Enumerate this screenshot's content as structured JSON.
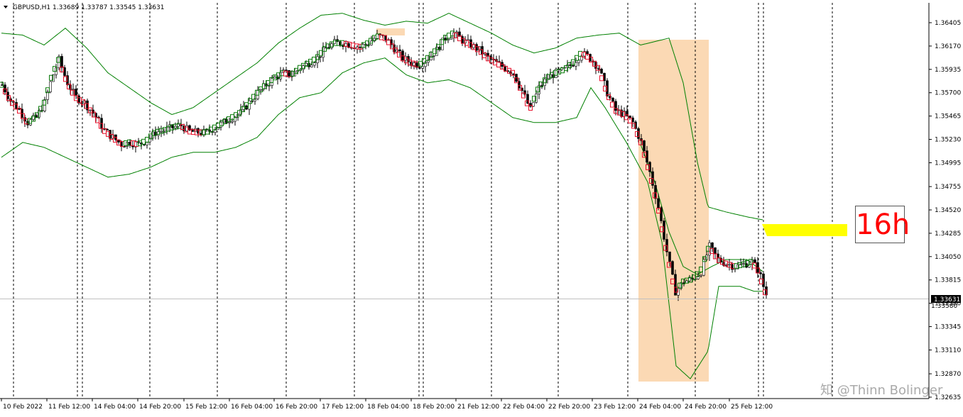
{
  "header": {
    "symbol": "GBPUSD,H1",
    "ohlc": "1.33689 1.33787 1.33545 1.33631",
    "dropdown_icon": "triangle-down-icon"
  },
  "price_label": "1.33631",
  "price_label_behind": "1.33580",
  "annotation": {
    "text": "16h",
    "text_color": "#ff0000",
    "yellow_band_color": "#ffff00"
  },
  "watermark": "@Thinn Bolinger",
  "watermark_icon": "zhihu-icon",
  "colors": {
    "candle": "#000000",
    "band_line": "#008000",
    "bear_box": "#e8102a",
    "bull_box": "#0a7a0a",
    "highlight": "#fbd9b4",
    "grid_sep": "#000000"
  },
  "chart_data": {
    "type": "candlestick",
    "title": "GBPUSD,H1",
    "y_ticks": [
      "1.36405",
      "1.36170",
      "1.35935",
      "1.35700",
      "1.35465",
      "1.35230",
      "1.34995",
      "1.34755",
      "1.34520",
      "1.34285",
      "1.34050",
      "1.33815",
      "1.33580",
      "1.33345",
      "1.33110",
      "1.32870",
      "1.32635"
    ],
    "ylim": [
      1.32635,
      1.366
    ],
    "x_ticks": [
      "10 Feb 2022",
      "11 Feb 12:00",
      "14 Feb 04:00",
      "14 Feb 20:00",
      "15 Feb 12:00",
      "16 Feb 04:00",
      "16 Feb 20:00",
      "17 Feb 12:00",
      "18 Feb 04:00",
      "18 Feb 20:00",
      "21 Feb 12:00",
      "22 Feb 04:00",
      "22 Feb 20:00",
      "23 Feb 12:00",
      "24 Feb 04:00",
      "24 Feb 20:00",
      "25 Feb 12:00"
    ],
    "price_path": [
      [
        0,
        1.3578
      ],
      [
        12,
        1.3562
      ],
      [
        24,
        1.3553
      ],
      [
        36,
        1.354
      ],
      [
        48,
        1.3545
      ],
      [
        60,
        1.356
      ],
      [
        70,
        1.3585
      ],
      [
        80,
        1.3603
      ],
      [
        92,
        1.358
      ],
      [
        104,
        1.3565
      ],
      [
        116,
        1.356
      ],
      [
        130,
        1.3548
      ],
      [
        144,
        1.3532
      ],
      [
        156,
        1.3525
      ],
      [
        168,
        1.3518
      ],
      [
        180,
        1.352
      ],
      [
        192,
        1.3518
      ],
      [
        204,
        1.3522
      ],
      [
        216,
        1.353
      ],
      [
        228,
        1.3532
      ],
      [
        240,
        1.3535
      ],
      [
        252,
        1.3537
      ],
      [
        264,
        1.3531
      ],
      [
        276,
        1.353
      ],
      [
        288,
        1.353
      ],
      [
        300,
        1.3535
      ],
      [
        312,
        1.354
      ],
      [
        324,
        1.3545
      ],
      [
        336,
        1.355
      ],
      [
        348,
        1.356
      ],
      [
        360,
        1.357
      ],
      [
        372,
        1.3578
      ],
      [
        384,
        1.3585
      ],
      [
        396,
        1.359
      ],
      [
        408,
        1.3588
      ],
      [
        420,
        1.3595
      ],
      [
        432,
        1.36
      ],
      [
        444,
        1.3605
      ],
      [
        456,
        1.3615
      ],
      [
        468,
        1.362
      ],
      [
        480,
        1.362
      ],
      [
        492,
        1.3618
      ],
      [
        504,
        1.3616
      ],
      [
        516,
        1.362
      ],
      [
        528,
        1.3627
      ],
      [
        540,
        1.3625
      ],
      [
        552,
        1.3615
      ],
      [
        564,
        1.3605
      ],
      [
        576,
        1.36
      ],
      [
        588,
        1.3598
      ],
      [
        600,
        1.3605
      ],
      [
        612,
        1.3613
      ],
      [
        624,
        1.3625
      ],
      [
        636,
        1.363
      ],
      [
        648,
        1.3623
      ],
      [
        660,
        1.3618
      ],
      [
        672,
        1.3613
      ],
      [
        684,
        1.3605
      ],
      [
        696,
        1.36
      ],
      [
        708,
        1.3595
      ],
      [
        720,
        1.359
      ],
      [
        732,
        1.3572
      ],
      [
        744,
        1.3553
      ],
      [
        756,
        1.3575
      ],
      [
        768,
        1.3585
      ],
      [
        780,
        1.359
      ],
      [
        792,
        1.3593
      ],
      [
        804,
        1.36
      ],
      [
        816,
        1.361
      ],
      [
        828,
        1.3605
      ],
      [
        840,
        1.3595
      ],
      [
        852,
        1.357
      ],
      [
        864,
        1.3552
      ],
      [
        876,
        1.3548
      ],
      [
        888,
        1.354
      ],
      [
        900,
        1.352
      ],
      [
        912,
        1.349
      ],
      [
        924,
        1.3455
      ],
      [
        936,
        1.341
      ],
      [
        948,
        1.337
      ],
      [
        960,
        1.338
      ],
      [
        972,
        1.3382
      ],
      [
        984,
        1.339
      ],
      [
        996,
        1.3415
      ],
      [
        1008,
        1.3402
      ],
      [
        1020,
        1.3398
      ],
      [
        1032,
        1.3395
      ],
      [
        1044,
        1.3397
      ],
      [
        1056,
        1.34
      ],
      [
        1066,
        1.339
      ],
      [
        1072,
        1.3375
      ],
      [
        1078,
        1.3363
      ]
    ],
    "bollinger_upper": [
      [
        0,
        1.363
      ],
      [
        30,
        1.3628
      ],
      [
        60,
        1.3618
      ],
      [
        90,
        1.3635
      ],
      [
        120,
        1.3615
      ],
      [
        150,
        1.359
      ],
      [
        180,
        1.3575
      ],
      [
        210,
        1.356
      ],
      [
        240,
        1.3548
      ],
      [
        270,
        1.3555
      ],
      [
        300,
        1.357
      ],
      [
        330,
        1.3585
      ],
      [
        360,
        1.36
      ],
      [
        390,
        1.362
      ],
      [
        420,
        1.3635
      ],
      [
        450,
        1.3648
      ],
      [
        480,
        1.365
      ],
      [
        510,
        1.3643
      ],
      [
        540,
        1.3638
      ],
      [
        570,
        1.3642
      ],
      [
        600,
        1.364
      ],
      [
        630,
        1.365
      ],
      [
        660,
        1.364
      ],
      [
        690,
        1.363
      ],
      [
        720,
        1.3618
      ],
      [
        750,
        1.361
      ],
      [
        780,
        1.3615
      ],
      [
        810,
        1.3625
      ],
      [
        840,
        1.3628
      ],
      [
        870,
        1.363
      ],
      [
        900,
        1.3618
      ],
      [
        940,
        1.3625
      ],
      [
        960,
        1.358
      ],
      [
        980,
        1.35
      ],
      [
        995,
        1.3455
      ],
      [
        1020,
        1.345
      ],
      [
        1050,
        1.3445
      ],
      [
        1072,
        1.3442
      ]
    ],
    "bollinger_lower": [
      [
        0,
        1.3505
      ],
      [
        30,
        1.352
      ],
      [
        60,
        1.3515
      ],
      [
        90,
        1.3505
      ],
      [
        120,
        1.3495
      ],
      [
        150,
        1.3485
      ],
      [
        180,
        1.3488
      ],
      [
        210,
        1.3495
      ],
      [
        240,
        1.3505
      ],
      [
        270,
        1.351
      ],
      [
        300,
        1.351
      ],
      [
        330,
        1.3515
      ],
      [
        360,
        1.3525
      ],
      [
        390,
        1.3548
      ],
      [
        420,
        1.3565
      ],
      [
        450,
        1.357
      ],
      [
        480,
        1.359
      ],
      [
        510,
        1.36
      ],
      [
        540,
        1.3605
      ],
      [
        570,
        1.3588
      ],
      [
        600,
        1.358
      ],
      [
        630,
        1.3583
      ],
      [
        660,
        1.3575
      ],
      [
        690,
        1.356
      ],
      [
        720,
        1.3545
      ],
      [
        750,
        1.354
      ],
      [
        780,
        1.354
      ],
      [
        810,
        1.3545
      ],
      [
        830,
        1.3575
      ],
      [
        850,
        1.3555
      ],
      [
        880,
        1.352
      ],
      [
        910,
        1.348
      ],
      [
        930,
        1.342
      ],
      [
        950,
        1.3295
      ],
      [
        970,
        1.3282
      ],
      [
        995,
        1.331
      ],
      [
        1010,
        1.3375
      ],
      [
        1040,
        1.3375
      ],
      [
        1060,
        1.337
      ],
      [
        1072,
        1.337
      ]
    ],
    "middle_band": [
      [
        900,
        1.3518
      ],
      [
        920,
        1.348
      ],
      [
        940,
        1.343
      ],
      [
        960,
        1.3395
      ],
      [
        980,
        1.3387
      ],
      [
        1000,
        1.3395
      ],
      [
        1020,
        1.3402
      ],
      [
        1050,
        1.3402
      ],
      [
        1072,
        1.339
      ]
    ]
  }
}
